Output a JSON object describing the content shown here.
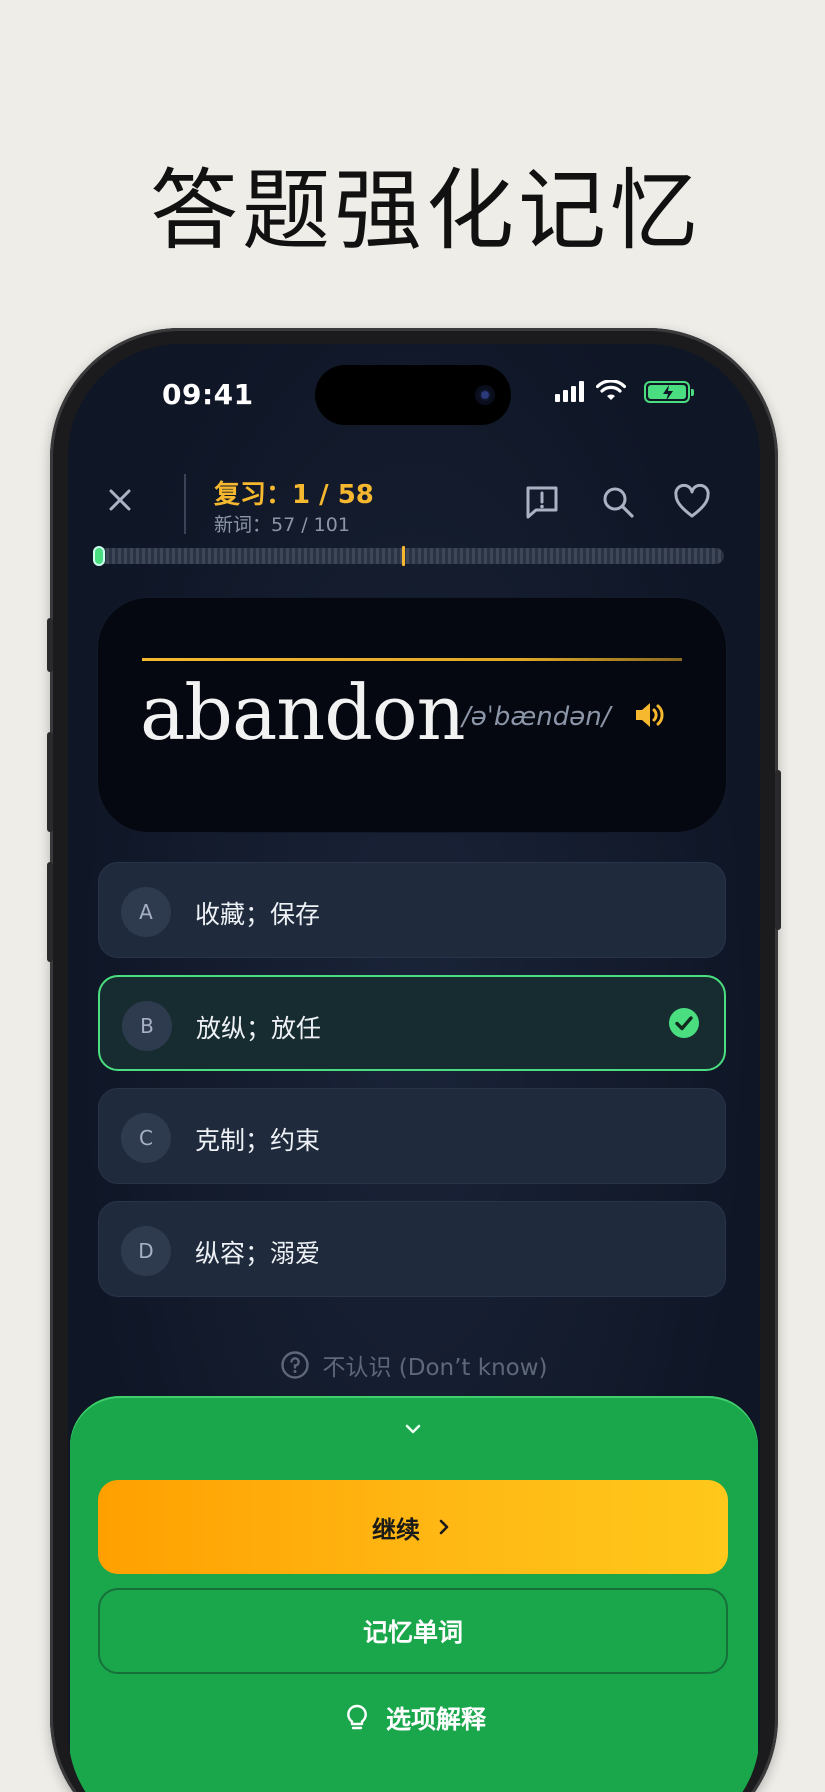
{
  "headline": "答题强化记忆",
  "status_bar": {
    "time": "09:41"
  },
  "header": {
    "review_progress": "复习：1 / 58",
    "new_words": "新词：57 / 101",
    "icons": [
      "close-icon",
      "report-icon",
      "search-icon",
      "heart-icon"
    ]
  },
  "progress": {
    "current": 1,
    "total": 58
  },
  "word_card": {
    "word": "abandon",
    "phonetic": "/əˈbændən/",
    "icon": "speaker-icon"
  },
  "options": [
    {
      "letter": "A",
      "text": "收藏；保存",
      "state": "default"
    },
    {
      "letter": "B",
      "text": "放纵；放任",
      "state": "correct"
    },
    {
      "letter": "C",
      "text": "克制；约束",
      "state": "default"
    },
    {
      "letter": "D",
      "text": "纵容；溺爱",
      "state": "default"
    }
  ],
  "dont_know": "不认识 (Don’t know)",
  "sheet": {
    "continue_label": "继续",
    "memorize_label": "记忆单词",
    "explain_label": "选项解释"
  },
  "colors": {
    "accent": "#f5b82e",
    "correct": "#4ade80",
    "sheet": "#1aa64a",
    "background": "#efede8"
  }
}
